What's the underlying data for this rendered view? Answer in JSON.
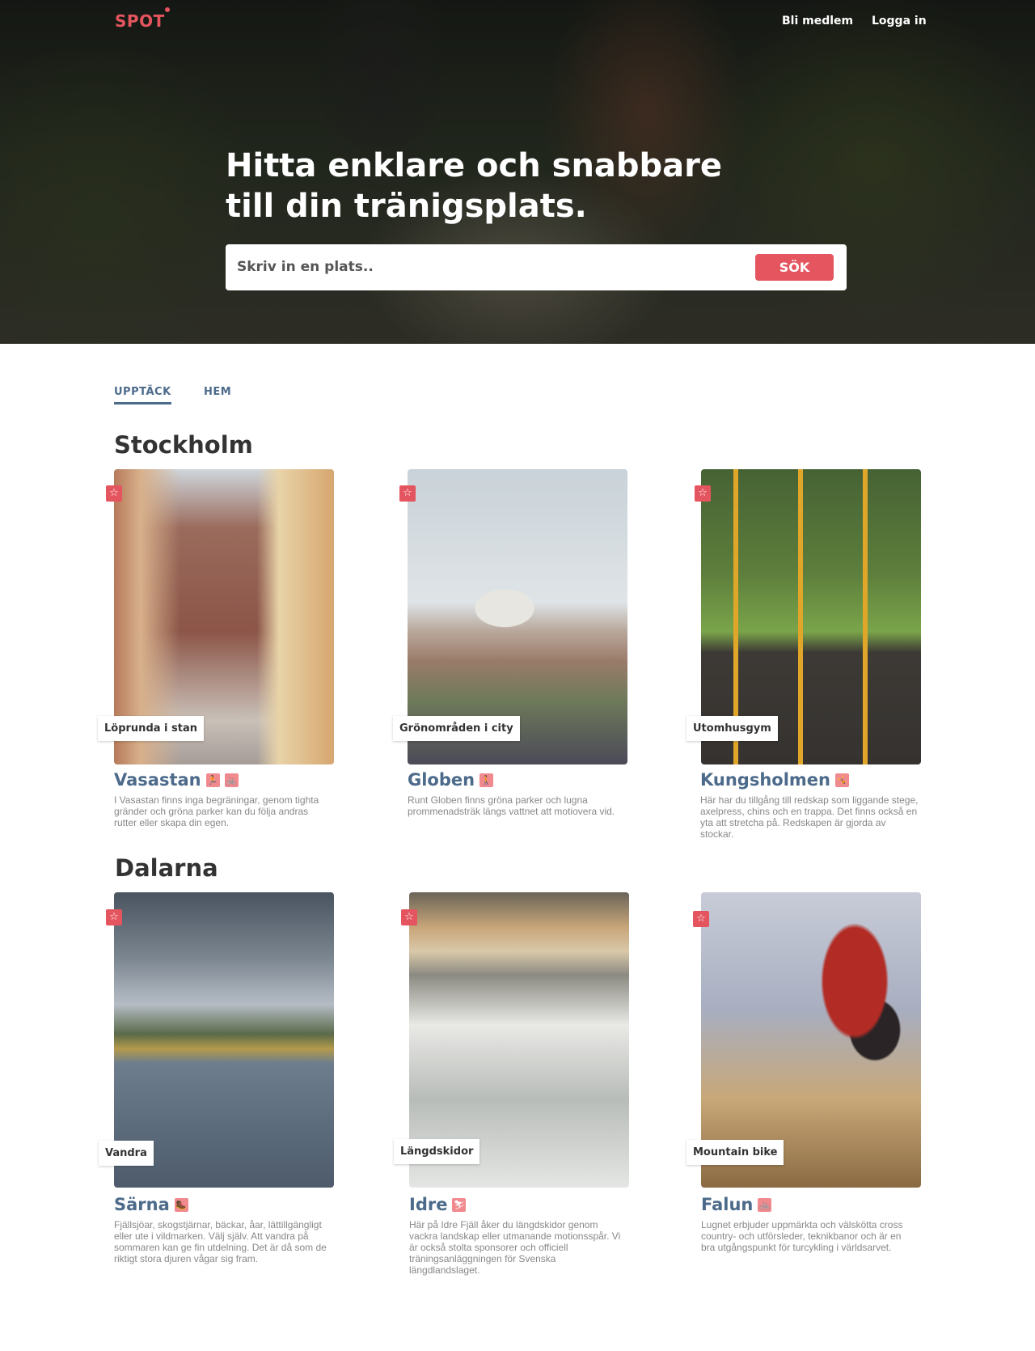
{
  "header": {
    "logo": "SPOT",
    "nav": {
      "join": "Bli medlem",
      "login": "Logga in"
    }
  },
  "hero": {
    "headline_line1": "Hitta enklare och snabbare",
    "headline_line2": "till din tränigsplats.",
    "search": {
      "placeholder": "Skriv in en plats..",
      "button": "SÖK"
    }
  },
  "tabs": {
    "discover": "UPPTÄCK",
    "home": "HEM"
  },
  "colors": {
    "accent": "#e4555f",
    "title_blue": "#4c6a8a",
    "icon_pink": "#f08a8f"
  },
  "regions": [
    {
      "name": "Stockholm",
      "cards": [
        {
          "tag": "Löprunda i stan",
          "title": "Vasastan",
          "icons": [
            "running-icon",
            "bicycle-icon"
          ],
          "desc": "I Vasastan finns inga begräningar, genom tighta gränder och gröna parker kan du följa andras rutter eller skapa din egen."
        },
        {
          "tag": "Grönområden i city",
          "title": "Globen",
          "icons": [
            "walking-icon"
          ],
          "desc": "Runt Globen finns gröna parker och lugna prommenadsträk längs vattnet att motiovera vid."
        },
        {
          "tag": "Utomhusgym",
          "title": "Kungsholmen",
          "icons": [
            "workout-icon"
          ],
          "desc": "Här har du tillgång till redskap som liggande stege, axelpress, chins och en trappa. Det finns också en yta att stretcha på. Redskapen är gjorda av stockar."
        }
      ]
    },
    {
      "name": "Dalarna",
      "cards": [
        {
          "tag": "Vandra",
          "title": "Särna",
          "icons": [
            "hiking-icon"
          ],
          "desc": "Fjällsjöar, skogstjärnar, bäckar, åar, lättillgängligt eller ute i vildmarken. Välj själv. Att vandra på sommaren kan ge fin utdelning. Det är då som de riktigt stora djuren vågar sig fram."
        },
        {
          "tag": "Längdskidor",
          "title": "Idre",
          "icons": [
            "ski-icon"
          ],
          "desc": "Här på Idre Fjäll åker du längdskidor genom vackra landskap eller utmanande motionsspår. Vi är också stolta sponsorer och officiell träningsanläggningen för Svenska längdlandslaget."
        },
        {
          "tag": "Mountain bike",
          "title": "Falun",
          "icons": [
            "bicycle-icon"
          ],
          "desc": "Lugnet erbjuder uppmärkta och välskötta cross country- och utförsleder, teknikbanor och är en bra utgångspunkt för turcykling i världsarvet."
        }
      ]
    }
  ]
}
